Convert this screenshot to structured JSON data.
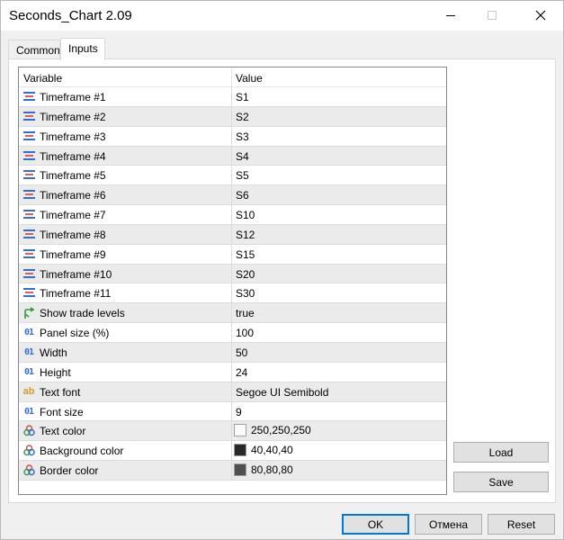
{
  "window": {
    "title": "Seconds_Chart 2.09"
  },
  "tabs": [
    {
      "label": "Common"
    },
    {
      "label": "Inputs"
    }
  ],
  "grid": {
    "columns": {
      "variable": "Variable",
      "value": "Value"
    },
    "rows": [
      {
        "icon": "timeframe-icon",
        "name": "Timeframe #1",
        "value": "S1"
      },
      {
        "icon": "timeframe-icon",
        "name": "Timeframe #2",
        "value": "S2"
      },
      {
        "icon": "timeframe-icon",
        "name": "Timeframe #3",
        "value": "S3"
      },
      {
        "icon": "timeframe-icon",
        "name": "Timeframe #4",
        "value": "S4"
      },
      {
        "icon": "timeframe-icon",
        "name": "Timeframe #5",
        "value": "S5"
      },
      {
        "icon": "timeframe-icon",
        "name": "Timeframe #6",
        "value": "S6"
      },
      {
        "icon": "timeframe-icon",
        "name": "Timeframe #7",
        "value": "S10"
      },
      {
        "icon": "timeframe-icon",
        "name": "Timeframe #8",
        "value": "S12"
      },
      {
        "icon": "timeframe-icon",
        "name": "Timeframe #9",
        "value": "S15"
      },
      {
        "icon": "timeframe-icon",
        "name": "Timeframe #10",
        "value": "S20"
      },
      {
        "icon": "timeframe-icon",
        "name": "Timeframe #11",
        "value": "S30"
      },
      {
        "icon": "bool-arrow-icon",
        "name": "Show trade levels",
        "value": "true"
      },
      {
        "icon": "integer-icon",
        "name": "Panel size (%)",
        "value": "100"
      },
      {
        "icon": "integer-icon",
        "name": "Width",
        "value": "50"
      },
      {
        "icon": "integer-icon",
        "name": "Height",
        "value": "24"
      },
      {
        "icon": "string-icon",
        "name": "Text font",
        "value": "Segoe UI Semibold"
      },
      {
        "icon": "integer-icon",
        "name": "Font size",
        "value": "9"
      },
      {
        "icon": "color-icon",
        "name": "Text color",
        "value": "250,250,250",
        "swatch": "#fafafa"
      },
      {
        "icon": "color-icon",
        "name": "Background color",
        "value": "40,40,40",
        "swatch": "#282828"
      },
      {
        "icon": "color-icon",
        "name": "Border color",
        "value": "80,80,80",
        "swatch": "#505050"
      }
    ]
  },
  "side_buttons": {
    "load": "Load",
    "save": "Save"
  },
  "footer_buttons": {
    "ok": "OK",
    "cancel": "Отмена",
    "reset": "Reset"
  },
  "colors": {
    "accent": "#0078d7",
    "grid_alt_row": "#ebebeb"
  }
}
